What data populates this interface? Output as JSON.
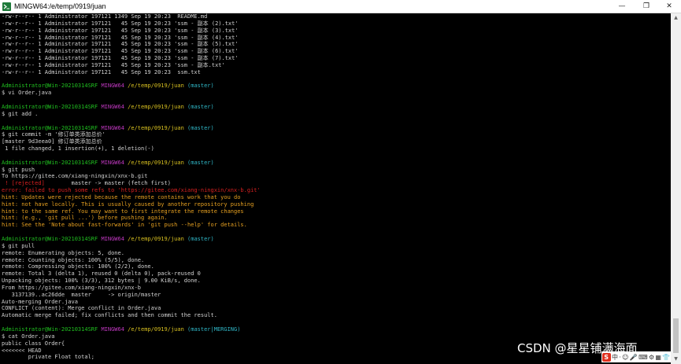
{
  "window": {
    "title": "MINGW64:/e/temp/0919/juan",
    "icon": "mingw-terminal-icon",
    "controls": {
      "minimize": "—",
      "restore": "❐",
      "close": "✕"
    }
  },
  "terminal": {
    "lines": [
      [
        [
          "w",
          "-rw-r--r-- 1 Administrator 197121 1349 Sep 19 20:23  README.md"
        ]
      ],
      [
        [
          "w",
          "-rw-r--r-- 1 Administrator 197121   45 Sep 19 20:23 'ssm - 副本 (2).txt'"
        ]
      ],
      [
        [
          "w",
          "-rw-r--r-- 1 Administrator 197121   45 Sep 19 20:23 'ssm - 副本 (3).txt'"
        ]
      ],
      [
        [
          "w",
          "-rw-r--r-- 1 Administrator 197121   45 Sep 19 20:23 'ssm - 副本 (4).txt'"
        ]
      ],
      [
        [
          "w",
          "-rw-r--r-- 1 Administrator 197121   45 Sep 19 20:23 'ssm - 副本 (5).txt'"
        ]
      ],
      [
        [
          "w",
          "-rw-r--r-- 1 Administrator 197121   45 Sep 19 20:23 'ssm - 副本 (6).txt'"
        ]
      ],
      [
        [
          "w",
          "-rw-r--r-- 1 Administrator 197121   45 Sep 19 20:23 'ssm - 副本 (7).txt'"
        ]
      ],
      [
        [
          "w",
          "-rw-r--r-- 1 Administrator 197121   45 Sep 19 20:23 'ssm - 副本.txt'"
        ]
      ],
      [
        [
          "w",
          "-rw-r--r-- 1 Administrator 197121   45 Sep 19 20:23  ssm.txt"
        ]
      ],
      [],
      [
        [
          "g",
          "Administrator@Win-20210314SRF "
        ],
        [
          "m",
          "MINGW64 "
        ],
        [
          "y",
          "/e/temp/0919/juan "
        ],
        [
          "c",
          "(master)"
        ]
      ],
      [
        [
          "w",
          "$ vi Order.java"
        ]
      ],
      [],
      [
        [
          "g",
          "Administrator@Win-20210314SRF "
        ],
        [
          "m",
          "MINGW64 "
        ],
        [
          "y",
          "/e/temp/0919/juan "
        ],
        [
          "c",
          "(master)"
        ]
      ],
      [
        [
          "w",
          "$ git add ."
        ]
      ],
      [],
      [
        [
          "g",
          "Administrator@Win-20210314SRF "
        ],
        [
          "m",
          "MINGW64 "
        ],
        [
          "y",
          "/e/temp/0919/juan "
        ],
        [
          "c",
          "(master)"
        ]
      ],
      [
        [
          "w",
          "$ git commit -m '修订单类添加总价'"
        ]
      ],
      [
        [
          "w",
          "[master 9d3eea0] 修订单类添加总价"
        ]
      ],
      [
        [
          "w",
          " 1 file changed, 1 insertion(+), 1 deletion(-)"
        ]
      ],
      [],
      [
        [
          "g",
          "Administrator@Win-20210314SRF "
        ],
        [
          "m",
          "MINGW64 "
        ],
        [
          "y",
          "/e/temp/0919/juan "
        ],
        [
          "c",
          "(master)"
        ]
      ],
      [
        [
          "w",
          "$ git push"
        ]
      ],
      [
        [
          "w",
          "To https://gitee.com/xiang-ningxin/xnx-b.git"
        ]
      ],
      [
        [
          "r",
          " ! [rejected]        "
        ],
        [
          "w",
          "master -> master (fetch first)"
        ]
      ],
      [
        [
          "r",
          "error: failed to push some refs to 'https://gitee.com/xiang-ningxin/xnx-b.git'"
        ]
      ],
      [
        [
          "o",
          "hint: Updates were rejected because the remote contains work that you do"
        ]
      ],
      [
        [
          "o",
          "hint: not have locally. This is usually caused by another repository pushing"
        ]
      ],
      [
        [
          "o",
          "hint: to the same ref. You may want to first integrate the remote changes"
        ]
      ],
      [
        [
          "o",
          "hint: (e.g., 'git pull ...') before pushing again."
        ]
      ],
      [
        [
          "o",
          "hint: See the 'Note about fast-forwards' in 'git push --help' for details."
        ]
      ],
      [],
      [
        [
          "g",
          "Administrator@Win-20210314SRF "
        ],
        [
          "m",
          "MINGW64 "
        ],
        [
          "y",
          "/e/temp/0919/juan "
        ],
        [
          "c",
          "(master)"
        ]
      ],
      [
        [
          "w",
          "$ git pull"
        ]
      ],
      [
        [
          "w",
          "remote: Enumerating objects: 5, done."
        ]
      ],
      [
        [
          "w",
          "remote: Counting objects: 100% (5/5), done."
        ]
      ],
      [
        [
          "w",
          "remote: Compressing objects: 100% (2/2), done."
        ]
      ],
      [
        [
          "w",
          "remote: Total 3 (delta 1), reused 0 (delta 0), pack-reused 0"
        ]
      ],
      [
        [
          "w",
          "Unpacking objects: 100% (3/3), 312 bytes | 9.00 KiB/s, done."
        ]
      ],
      [
        [
          "w",
          "From https://gitee.com/xiang-ningxin/xnx-b"
        ]
      ],
      [
        [
          "w",
          "   3137139..ac26dde  master     -> origin/master"
        ]
      ],
      [
        [
          "w",
          "Auto-merging Order.java"
        ]
      ],
      [
        [
          "w",
          "CONFLICT (content): Merge conflict in Order.java"
        ]
      ],
      [
        [
          "w",
          "Automatic merge failed; fix conflicts and then commit the result."
        ]
      ],
      [],
      [
        [
          "g",
          "Administrator@Win-20210314SRF "
        ],
        [
          "m",
          "MINGW64 "
        ],
        [
          "y",
          "/e/temp/0919/juan "
        ],
        [
          "c",
          "(master|MERGING)"
        ]
      ],
      [
        [
          "w",
          "$ cat Order.java"
        ]
      ],
      [
        [
          "w",
          "public class Order{"
        ]
      ],
      [
        [
          "w",
          "<<<<<<< HEAD"
        ]
      ],
      [
        [
          "w",
          "        private Float total;"
        ]
      ]
    ]
  },
  "watermark": {
    "text": "CSDN @星星铺满海面"
  },
  "ime_toolbar": {
    "s_label": "S",
    "items": [
      "中",
      "·",
      "☺",
      "🎤",
      "⌨",
      "⚙",
      "▦",
      "👕"
    ]
  },
  "colors": {
    "user_host": "#20c020",
    "mingw": "#c038c0",
    "path": "#d8c020",
    "branch": "#30b8c8",
    "error": "#d82020",
    "hint": "#e6a020"
  }
}
